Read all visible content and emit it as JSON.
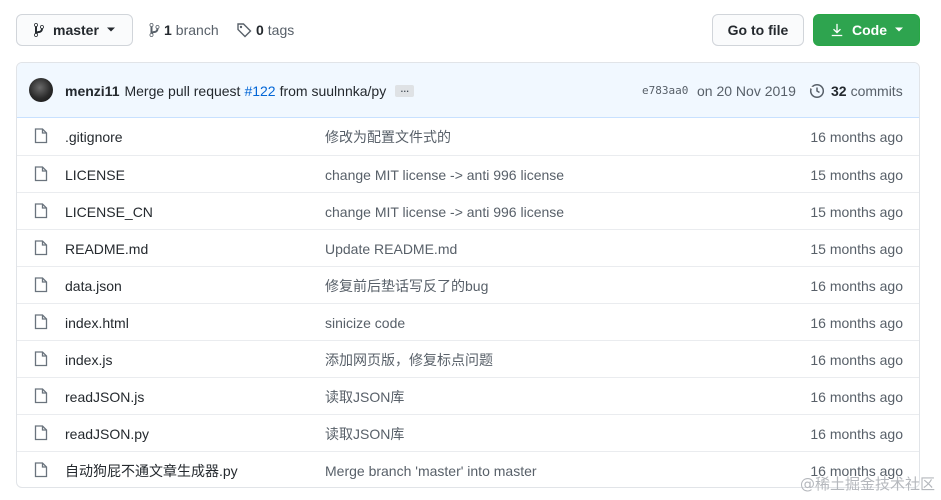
{
  "topbar": {
    "branch_name": "master",
    "branch_count": "1",
    "branch_label": "branch",
    "tag_count": "0",
    "tag_label": "tags",
    "goto_file_label": "Go to file",
    "code_label": "Code"
  },
  "commit": {
    "author": "menzi11",
    "message_prefix": "Merge pull request",
    "pr_number": "#122",
    "message_suffix": "from suulnnka/py",
    "ellipsis": "…",
    "sha": "e783aa0",
    "date": "on 20 Nov 2019",
    "commits_count": "32",
    "commits_label": "commits"
  },
  "files": [
    {
      "name": ".gitignore",
      "message": "修改为配置文件式的",
      "age": "16 months ago",
      "icon": "file-icon"
    },
    {
      "name": "LICENSE",
      "message": "change MIT license -> anti 996 license",
      "age": "15 months ago",
      "icon": "file-icon"
    },
    {
      "name": "LICENSE_CN",
      "message": "change MIT license -> anti 996 license",
      "age": "15 months ago",
      "icon": "file-icon"
    },
    {
      "name": "README.md",
      "message": "Update README.md",
      "age": "15 months ago",
      "icon": "file-icon"
    },
    {
      "name": "data.json",
      "message": "修复前后垫话写反了的bug",
      "age": "16 months ago",
      "icon": "file-icon"
    },
    {
      "name": "index.html",
      "message": "sinicize code",
      "age": "16 months ago",
      "icon": "file-icon"
    },
    {
      "name": "index.js",
      "message": "添加网页版，修复标点问题",
      "age": "16 months ago",
      "icon": "file-icon"
    },
    {
      "name": "readJSON.js",
      "message": "读取JSON库",
      "age": "16 months ago",
      "icon": "file-icon"
    },
    {
      "name": "readJSON.py",
      "message": "读取JSON库",
      "age": "16 months ago",
      "icon": "file-icon"
    },
    {
      "name": "自动狗屁不通文章生成器.py",
      "message": "Merge branch 'master' into master",
      "age": "16 months ago",
      "icon": "file-icon"
    }
  ],
  "watermark": "@稀土掘金技术社区",
  "colors": {
    "accent_green": "#2ea44f",
    "link_blue": "#0366d6",
    "commit_bar_bg": "#f1f8ff"
  }
}
